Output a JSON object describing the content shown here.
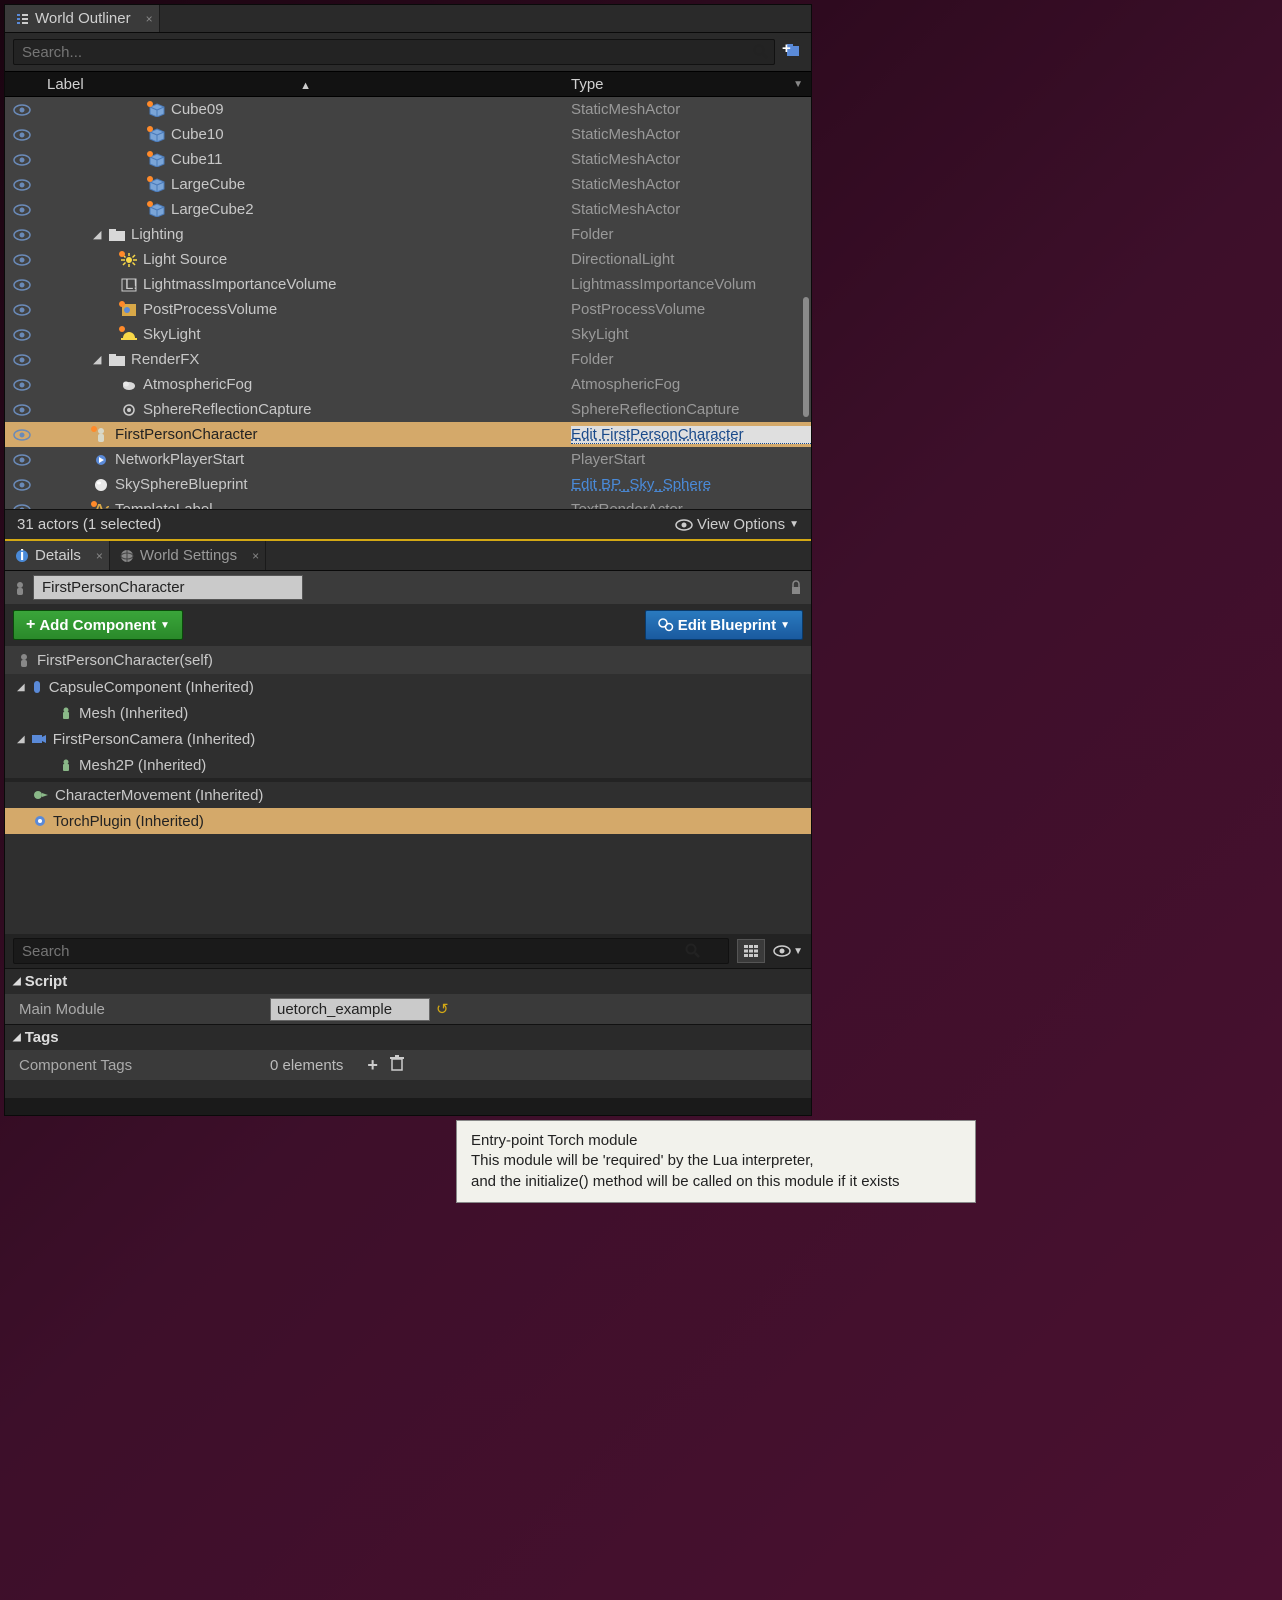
{
  "outliner": {
    "title": "World Outliner",
    "search_placeholder": "Search...",
    "headers": {
      "label": "Label",
      "type": "Type"
    },
    "rows": [
      {
        "depth": 3,
        "icon": "cube",
        "dot": true,
        "label": "Cube09",
        "type": "StaticMeshActor"
      },
      {
        "depth": 3,
        "icon": "cube",
        "dot": true,
        "label": "Cube10",
        "type": "StaticMeshActor"
      },
      {
        "depth": 3,
        "icon": "cube",
        "dot": true,
        "label": "Cube11",
        "type": "StaticMeshActor"
      },
      {
        "depth": 3,
        "icon": "cube",
        "dot": true,
        "label": "LargeCube",
        "type": "StaticMeshActor"
      },
      {
        "depth": 3,
        "icon": "cube",
        "dot": true,
        "label": "LargeCube2",
        "type": "StaticMeshActor"
      },
      {
        "depth": 1,
        "expander": "down",
        "icon": "folder",
        "label": "Lighting",
        "type": "Folder"
      },
      {
        "depth": 2,
        "icon": "light",
        "dot": true,
        "label": "Light Source",
        "type": "DirectionalLight"
      },
      {
        "depth": 2,
        "icon": "lightmass",
        "label": "LightmassImportanceVolume",
        "type": "LightmassImportanceVolum"
      },
      {
        "depth": 2,
        "icon": "postprocess",
        "dot": true,
        "label": "PostProcessVolume",
        "type": "PostProcessVolume"
      },
      {
        "depth": 2,
        "icon": "skylight",
        "dot": true,
        "label": "SkyLight",
        "type": "SkyLight"
      },
      {
        "depth": 1,
        "expander": "down",
        "icon": "folder",
        "label": "RenderFX",
        "type": "Folder"
      },
      {
        "depth": 2,
        "icon": "fog",
        "label": "AtmosphericFog",
        "type": "AtmosphericFog"
      },
      {
        "depth": 2,
        "icon": "reflect",
        "label": "SphereReflectionCapture",
        "type": "SphereReflectionCapture"
      },
      {
        "depth": 1,
        "icon": "character",
        "dot": true,
        "label": "FirstPersonCharacter",
        "type": "Edit FirstPersonCharacter",
        "selected": true,
        "link": true
      },
      {
        "depth": 1,
        "icon": "netstart",
        "label": "NetworkPlayerStart",
        "type": "PlayerStart"
      },
      {
        "depth": 1,
        "icon": "sphere",
        "label": "SkySphereBlueprint",
        "type": "Edit BP_Sky_Sphere",
        "link": true
      },
      {
        "depth": 1,
        "icon": "text",
        "dot": true,
        "label": "TemplateLabel",
        "type": "TextRenderActor"
      }
    ],
    "status": "31 actors (1 selected)",
    "view_options": "View Options"
  },
  "details": {
    "tabs": {
      "details": "Details",
      "world_settings": "World Settings"
    },
    "actor_label": "FirstPersonCharacter",
    "add_component": "Add Component",
    "edit_blueprint": "Edit Blueprint",
    "components": [
      {
        "icon": "pawn",
        "label": "FirstPersonCharacter(self)",
        "depth": 0,
        "root": true
      },
      {
        "icon": "capsule",
        "label": "CapsuleComponent (Inherited)",
        "depth": 0,
        "expander": "down"
      },
      {
        "icon": "mesh",
        "label": "Mesh (Inherited)",
        "depth": 1
      },
      {
        "icon": "camera",
        "label": "FirstPersonCamera (Inherited)",
        "depth": 0,
        "expander": "down"
      },
      {
        "icon": "mesh",
        "label": "Mesh2P (Inherited)",
        "depth": 1
      },
      {
        "gap": true
      },
      {
        "icon": "movement",
        "label": "CharacterMovement (Inherited)",
        "depth": 0
      },
      {
        "icon": "torch",
        "label": "TorchPlugin (Inherited)",
        "depth": 0,
        "selected": true
      }
    ],
    "search_placeholder": "Search",
    "categories": {
      "script": {
        "title": "Script",
        "main_module_label": "Main Module",
        "main_module_value": "uetorch_example"
      },
      "tags": {
        "title": "Tags",
        "component_tags_label": "Component Tags",
        "elements": "0 elements"
      }
    }
  },
  "tooltip": {
    "line1": "Entry-point Torch module",
    "line2": "This module will be 'required' by the Lua interpreter,",
    "line3": "and the initialize() method will be called on this module if it exists"
  }
}
